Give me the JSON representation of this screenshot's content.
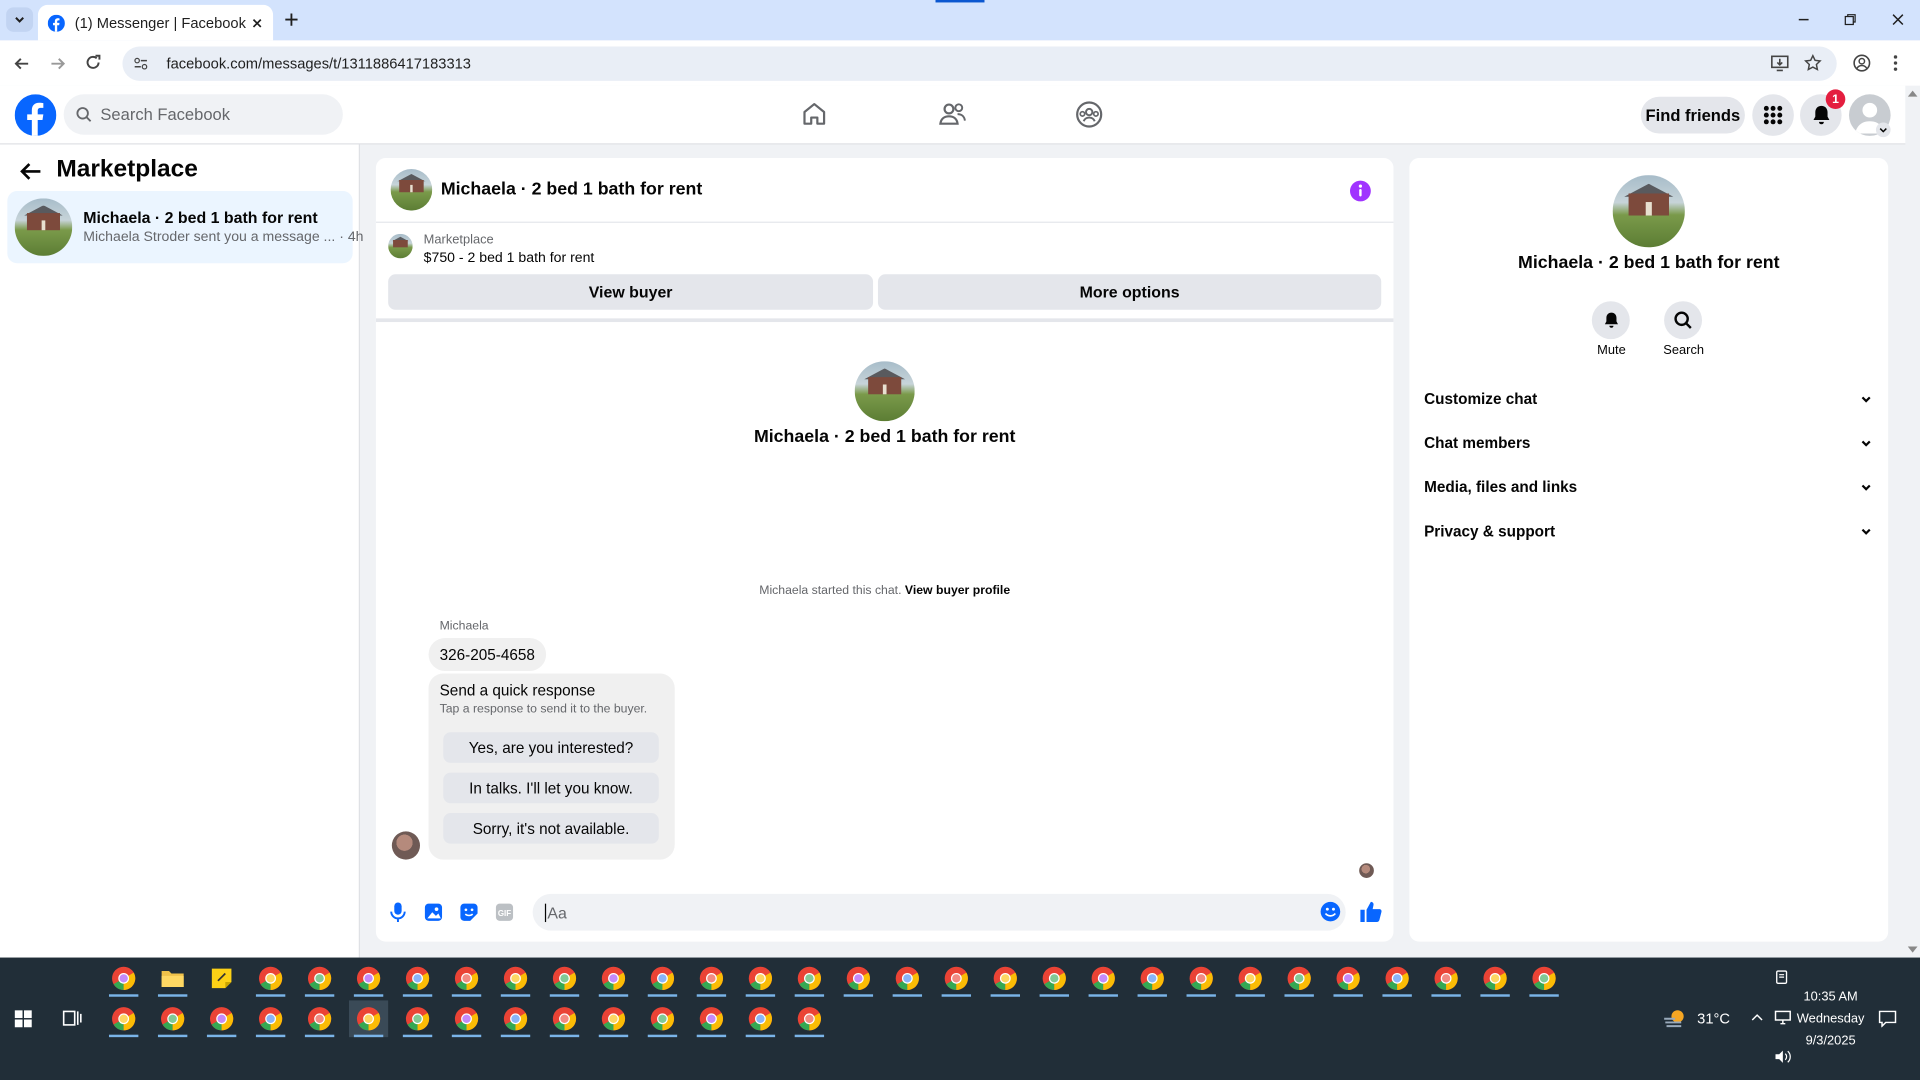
{
  "browser": {
    "tab_title": "(1) Messenger | Facebook",
    "url": "facebook.com/messages/t/1311886417183313"
  },
  "header": {
    "search_placeholder": "Search Facebook",
    "find_friends": "Find friends",
    "notif_count": "1"
  },
  "left": {
    "title": "Marketplace",
    "conversation": {
      "name": "Michaela · 2 bed 1 bath for rent",
      "preview": "Michaela Stroder sent you a message ...",
      "time": "· 4h"
    }
  },
  "chat": {
    "title": "Michaela · 2 bed 1 bath for rent",
    "listing_label": "Marketplace",
    "listing_text": "$750 - 2 bed 1 bath for rent",
    "view_buyer": "View buyer",
    "more_options": "More options",
    "intro_name": "Michaela · 2 bed 1 bath for rent",
    "started_text": "Michaela started this chat.",
    "view_buyer_profile": "View buyer profile",
    "sender": "Michaela",
    "message": "326-205-4658",
    "quick_title": "Send a quick response",
    "quick_sub": "Tap a response to send it to the buyer.",
    "quick_responses": [
      "Yes, are you interested?",
      "In talks. I'll let you know.",
      "Sorry, it's not available."
    ],
    "input_placeholder": "Aa"
  },
  "right": {
    "name": "Michaela · 2 bed 1 bath for rent",
    "mute": "Mute",
    "search": "Search",
    "sections": [
      "Customize chat",
      "Chat members",
      "Media, files and links",
      "Privacy & support"
    ]
  },
  "taskbar": {
    "temp": "31°C",
    "time": "10:35 AM",
    "day": "Wednesday",
    "date": "9/3/2025"
  },
  "colors": {
    "fb_blue": "#0866ff",
    "messenger_purple": "#a033ff",
    "taskbar": "#212e38"
  }
}
